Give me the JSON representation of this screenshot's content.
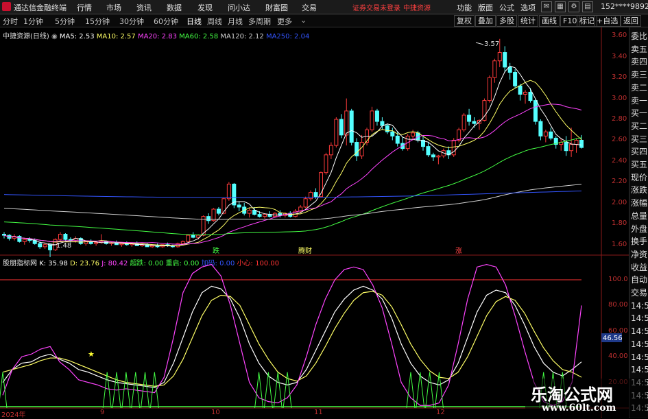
{
  "app": {
    "name": "通达信金融终端"
  },
  "menu": [
    "行情",
    "市场",
    "资讯",
    "数据",
    "发现",
    "问小达",
    "財富圈",
    "交易"
  ],
  "warning": "证券交易未登录",
  "stock_short": "中捷资源",
  "right_menu": [
    "功能",
    "版面",
    "公式",
    "选项"
  ],
  "user": "152****9892",
  "periods": [
    "分时",
    "1分钟",
    "5分钟",
    "15分钟",
    "30分钟",
    "60分钟",
    "日线",
    "周线",
    "月线",
    "多周期",
    "更多"
  ],
  "active_period": "日线",
  "tools": [
    "复权",
    "叠加",
    "多股",
    "统计",
    "画线",
    "F10",
    "标记",
    "+自选",
    "返回"
  ],
  "main_legend": {
    "title": "中捷资源(日线)",
    "items": [
      {
        "text": "MA5: 2.53",
        "color": "#ffffff"
      },
      {
        "text": "MA10: 2.57",
        "color": "#ffff66"
      },
      {
        "text": "MA20: 2.83",
        "color": "#ff44ff"
      },
      {
        "text": "MA60: 2.58",
        "color": "#44ff44"
      },
      {
        "text": "MA120: 2.12",
        "color": "#d0d0d0"
      },
      {
        "text": "MA250: 2.04",
        "color": "#3355ff"
      }
    ]
  },
  "sub_legend": {
    "title": "股朋指标网",
    "items": [
      {
        "text": "K: 35.98",
        "color": "#ffffff"
      },
      {
        "text": "D: 23.76",
        "color": "#ffff66"
      },
      {
        "text": "J: 80.42",
        "color": "#ff44ff"
      },
      {
        "text": "超跌: 0.00",
        "color": "#44ff44"
      },
      {
        "text": "重启: 0.00",
        "color": "#44ff44"
      },
      {
        "text": "加码: 0.00",
        "color": "#3355ff"
      },
      {
        "text": "小心: 100.00",
        "color": "#ff3333"
      }
    ]
  },
  "price_axis": [
    "3.60",
    "3.40",
    "3.20",
    "3.00",
    "2.80",
    "2.60",
    "2.40",
    "2.20",
    "2.00",
    "1.80",
    "1.60"
  ],
  "sub_axis": [
    "100.0",
    "80.00",
    "60.00",
    "40.00",
    "20.00"
  ],
  "current_value": "46.56",
  "annotations": {
    "high": "3.57",
    "low": "1.48"
  },
  "markers": [
    "跌",
    "腾财",
    "涨"
  ],
  "x_labels": [
    "2024年",
    "9",
    "10",
    "11",
    "12"
  ],
  "right_panel": [
    "委比",
    "卖五",
    "卖四",
    "卖三",
    "卖二",
    "卖一",
    "买一",
    "买二",
    "买三",
    "买四",
    "买五",
    "现价",
    "涨跌",
    "涨幅",
    "总量",
    "外盘",
    "换手",
    "净资",
    "收益",
    "自动",
    "交易",
    "14:56",
    "14:56",
    "14:56",
    "14:56",
    "14:56",
    "14:56",
    "14:56",
    "14:56",
    "14:56"
  ],
  "watermark": {
    "line1": "乐淘公式网",
    "line2": "www.60lt.com"
  },
  "chart_data": [
    {
      "type": "candlestick",
      "title": "中捷资源(日线)",
      "ylim": [
        1.5,
        3.68
      ],
      "ohlc": [
        [
          1.7,
          1.72,
          1.66,
          1.69
        ],
        [
          1.69,
          1.7,
          1.64,
          1.66
        ],
        [
          1.66,
          1.7,
          1.64,
          1.68
        ],
        [
          1.68,
          1.69,
          1.62,
          1.63
        ],
        [
          1.63,
          1.66,
          1.6,
          1.65
        ],
        [
          1.65,
          1.67,
          1.62,
          1.64
        ],
        [
          1.64,
          1.66,
          1.6,
          1.61
        ],
        [
          1.61,
          1.63,
          1.56,
          1.58
        ],
        [
          1.58,
          1.62,
          1.56,
          1.6
        ],
        [
          1.6,
          1.61,
          1.48,
          1.55
        ],
        [
          1.55,
          1.66,
          1.54,
          1.65
        ],
        [
          1.65,
          1.72,
          1.63,
          1.7
        ],
        [
          1.7,
          1.71,
          1.64,
          1.65
        ],
        [
          1.65,
          1.67,
          1.62,
          1.64
        ],
        [
          1.64,
          1.68,
          1.62,
          1.66
        ],
        [
          1.66,
          1.67,
          1.6,
          1.61
        ],
        [
          1.61,
          1.64,
          1.59,
          1.63
        ],
        [
          1.63,
          1.65,
          1.6,
          1.61
        ],
        [
          1.61,
          1.63,
          1.59,
          1.62
        ],
        [
          1.62,
          1.7,
          1.61,
          1.63
        ],
        [
          1.63,
          1.64,
          1.6,
          1.61
        ],
        [
          1.61,
          1.63,
          1.59,
          1.62
        ],
        [
          1.62,
          1.64,
          1.6,
          1.6
        ],
        [
          1.6,
          1.62,
          1.58,
          1.61
        ],
        [
          1.61,
          1.63,
          1.59,
          1.6
        ],
        [
          1.6,
          1.62,
          1.58,
          1.61
        ],
        [
          1.61,
          1.63,
          1.59,
          1.59
        ],
        [
          1.59,
          1.61,
          1.58,
          1.6
        ],
        [
          1.6,
          1.62,
          1.58,
          1.58
        ],
        [
          1.58,
          1.6,
          1.57,
          1.59
        ],
        [
          1.59,
          1.61,
          1.57,
          1.58
        ],
        [
          1.58,
          1.6,
          1.57,
          1.6
        ],
        [
          1.6,
          1.62,
          1.58,
          1.59
        ],
        [
          1.59,
          1.6,
          1.57,
          1.58
        ],
        [
          1.58,
          1.62,
          1.57,
          1.61
        ],
        [
          1.61,
          1.64,
          1.6,
          1.63
        ],
        [
          1.63,
          1.7,
          1.62,
          1.69
        ],
        [
          1.69,
          1.72,
          1.66,
          1.67
        ],
        [
          1.67,
          1.7,
          1.65,
          1.69
        ],
        [
          1.69,
          1.88,
          1.68,
          1.87
        ],
        [
          1.87,
          1.9,
          1.8,
          1.83
        ],
        [
          1.83,
          1.95,
          1.82,
          1.94
        ],
        [
          1.94,
          1.96,
          1.88,
          1.9
        ],
        [
          1.9,
          2.05,
          1.89,
          2.04
        ],
        [
          2.04,
          2.2,
          2.02,
          2.18
        ],
        [
          2.18,
          2.19,
          1.95,
          1.98
        ],
        [
          1.98,
          2.01,
          1.92,
          1.96
        ],
        [
          1.96,
          2.0,
          1.88,
          1.9
        ],
        [
          1.9,
          1.95,
          1.86,
          1.93
        ],
        [
          1.93,
          1.96,
          1.88,
          1.89
        ],
        [
          1.89,
          1.92,
          1.86,
          1.87
        ],
        [
          1.87,
          1.9,
          1.85,
          1.89
        ],
        [
          1.89,
          1.92,
          1.86,
          1.87
        ],
        [
          1.87,
          1.91,
          1.86,
          1.9
        ],
        [
          1.9,
          1.93,
          1.86,
          1.88
        ],
        [
          1.88,
          1.91,
          1.86,
          1.9
        ],
        [
          1.9,
          1.92,
          1.86,
          1.87
        ],
        [
          1.87,
          1.94,
          1.86,
          1.92
        ],
        [
          1.92,
          1.98,
          1.9,
          1.96
        ],
        [
          1.96,
          2.06,
          1.95,
          2.04
        ],
        [
          2.04,
          2.12,
          2.02,
          2.1
        ],
        [
          2.1,
          2.14,
          2.04,
          2.06
        ],
        [
          2.06,
          2.3,
          2.05,
          2.29
        ],
        [
          2.29,
          2.48,
          2.27,
          2.46
        ],
        [
          2.46,
          2.58,
          2.42,
          2.55
        ],
        [
          2.55,
          2.82,
          2.53,
          2.8
        ],
        [
          2.8,
          2.85,
          2.62,
          2.65
        ],
        [
          2.65,
          3.0,
          2.55,
          2.88
        ],
        [
          2.88,
          2.9,
          2.55,
          2.58
        ],
        [
          2.58,
          2.62,
          2.4,
          2.45
        ],
        [
          2.45,
          2.65,
          2.42,
          2.58
        ],
        [
          2.58,
          2.72,
          2.55,
          2.7
        ],
        [
          2.7,
          2.92,
          2.68,
          2.88
        ],
        [
          2.88,
          2.9,
          2.74,
          2.78
        ],
        [
          2.78,
          2.82,
          2.7,
          2.74
        ],
        [
          2.74,
          2.76,
          2.66,
          2.68
        ],
        [
          2.68,
          2.72,
          2.6,
          2.64
        ],
        [
          2.64,
          2.68,
          2.54,
          2.57
        ],
        [
          2.57,
          2.63,
          2.5,
          2.52
        ],
        [
          2.52,
          2.66,
          2.5,
          2.64
        ],
        [
          2.64,
          2.7,
          2.6,
          2.67
        ],
        [
          2.67,
          2.69,
          2.58,
          2.6
        ],
        [
          2.6,
          2.64,
          2.5,
          2.54
        ],
        [
          2.54,
          2.58,
          2.44,
          2.46
        ],
        [
          2.46,
          2.48,
          2.4,
          2.44
        ],
        [
          2.44,
          2.46,
          2.37,
          2.45
        ],
        [
          2.45,
          2.52,
          2.43,
          2.5
        ],
        [
          2.5,
          2.54,
          2.42,
          2.46
        ],
        [
          2.46,
          2.62,
          2.44,
          2.6
        ],
        [
          2.6,
          2.72,
          2.58,
          2.7
        ],
        [
          2.7,
          2.86,
          2.68,
          2.84
        ],
        [
          2.84,
          2.9,
          2.74,
          2.78
        ],
        [
          2.78,
          2.82,
          2.72,
          2.76
        ],
        [
          2.76,
          2.8,
          2.7,
          2.79
        ],
        [
          2.79,
          3.0,
          2.78,
          2.98
        ],
        [
          2.98,
          3.22,
          2.96,
          3.2
        ],
        [
          3.2,
          3.38,
          3.15,
          3.36
        ],
        [
          3.36,
          3.57,
          3.3,
          3.44
        ],
        [
          3.44,
          3.5,
          3.25,
          3.3
        ],
        [
          3.3,
          3.34,
          3.18,
          3.25
        ],
        [
          3.25,
          3.28,
          3.1,
          3.12
        ],
        [
          3.12,
          3.14,
          2.98,
          3.04
        ],
        [
          3.04,
          3.08,
          2.95,
          3.06
        ],
        [
          3.06,
          3.1,
          2.96,
          2.98
        ],
        [
          2.98,
          3.0,
          2.75,
          2.78
        ],
        [
          2.78,
          2.8,
          2.6,
          2.64
        ],
        [
          2.64,
          2.7,
          2.58,
          2.68
        ],
        [
          2.68,
          2.72,
          2.6,
          2.62
        ],
        [
          2.62,
          2.64,
          2.52,
          2.56
        ],
        [
          2.56,
          2.62,
          2.5,
          2.58
        ],
        [
          2.58,
          2.64,
          2.45,
          2.5
        ],
        [
          2.5,
          2.72,
          2.44,
          2.56
        ],
        [
          2.56,
          2.62,
          2.48,
          2.6
        ],
        [
          2.6,
          2.65,
          2.52,
          2.53
        ]
      ]
    },
    {
      "type": "line",
      "title": "股朋指标网",
      "ylim": [
        0,
        115
      ],
      "series": [
        {
          "name": "K",
          "values": [
            20,
            30,
            35,
            36,
            40,
            42,
            38,
            35,
            30,
            28,
            25,
            22,
            20,
            19,
            18,
            17,
            16,
            20,
            35,
            55,
            75,
            90,
            95,
            93,
            85,
            70,
            50,
            35,
            25,
            20,
            18,
            20,
            30,
            45,
            60,
            75,
            85,
            92,
            95,
            92,
            85,
            70,
            50,
            35,
            25,
            20,
            18,
            22,
            35,
            55,
            75,
            88,
            92,
            90,
            80,
            65,
            48,
            35,
            28,
            25,
            30,
            36
          ]
        },
        {
          "name": "D",
          "values": [
            28,
            30,
            32,
            34,
            37,
            39,
            39,
            37,
            34,
            31,
            28,
            25,
            22,
            20,
            19,
            18,
            17,
            18,
            25,
            38,
            55,
            72,
            84,
            88,
            87,
            80,
            65,
            50,
            38,
            28,
            23,
            21,
            25,
            35,
            48,
            62,
            74,
            84,
            90,
            91,
            88,
            79,
            65,
            50,
            38,
            29,
            24,
            23,
            28,
            40,
            56,
            72,
            83,
            87,
            84,
            74,
            60,
            47,
            37,
            30,
            28,
            24
          ]
        },
        {
          "name": "J",
          "values": [
            10,
            30,
            40,
            42,
            46,
            48,
            36,
            30,
            22,
            20,
            18,
            15,
            14,
            15,
            14,
            13,
            12,
            24,
            55,
            90,
            105,
            110,
            112,
            103,
            80,
            50,
            20,
            8,
            5,
            4,
            8,
            18,
            40,
            65,
            85,
            100,
            108,
            110,
            108,
            96,
            78,
            50,
            20,
            8,
            2,
            2,
            4,
            18,
            50,
            85,
            110,
            112,
            110,
            96,
            72,
            45,
            20,
            5,
            2,
            5,
            20,
            80
          ]
        }
      ]
    }
  ]
}
